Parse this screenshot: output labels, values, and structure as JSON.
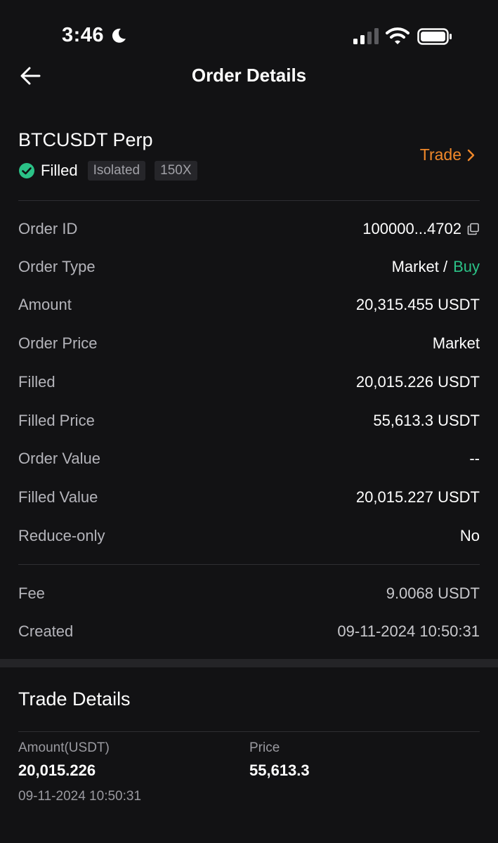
{
  "status_bar": {
    "time": "3:46"
  },
  "header": {
    "title": "Order Details"
  },
  "summary": {
    "symbol": "BTCUSDT Perp",
    "status": "Filled",
    "tags": [
      "Isolated",
      "150X"
    ],
    "trade_link": "Trade"
  },
  "details": [
    {
      "label": "Order ID",
      "value": "100000...4702"
    },
    {
      "label": "Order Type",
      "value": "Market /",
      "extra": "Buy"
    },
    {
      "label": "Amount",
      "value": "20,315.455 USDT"
    },
    {
      "label": "Order Price",
      "value": "Market"
    },
    {
      "label": "Filled",
      "value": "20,015.226 USDT"
    },
    {
      "label": "Filled Price",
      "value": "55,613.3 USDT"
    },
    {
      "label": "Order Value",
      "value": "--"
    },
    {
      "label": "Filled Value",
      "value": "20,015.227 USDT"
    },
    {
      "label": "Reduce-only",
      "value": "No"
    }
  ],
  "fees": [
    {
      "label": "Fee",
      "value": "9.0068 USDT"
    },
    {
      "label": "Created",
      "value": "09-11-2024 10:50:31"
    }
  ],
  "trade_details": {
    "title": "Trade Details",
    "amount_label": "Amount(USDT)",
    "amount_value": "20,015.226",
    "price_label": "Price",
    "price_value": "55,613.3",
    "time": "09-11-2024 10:50:31"
  },
  "colors": {
    "accent": "#f0882a",
    "buy": "#2bc287",
    "background": "#121214"
  }
}
